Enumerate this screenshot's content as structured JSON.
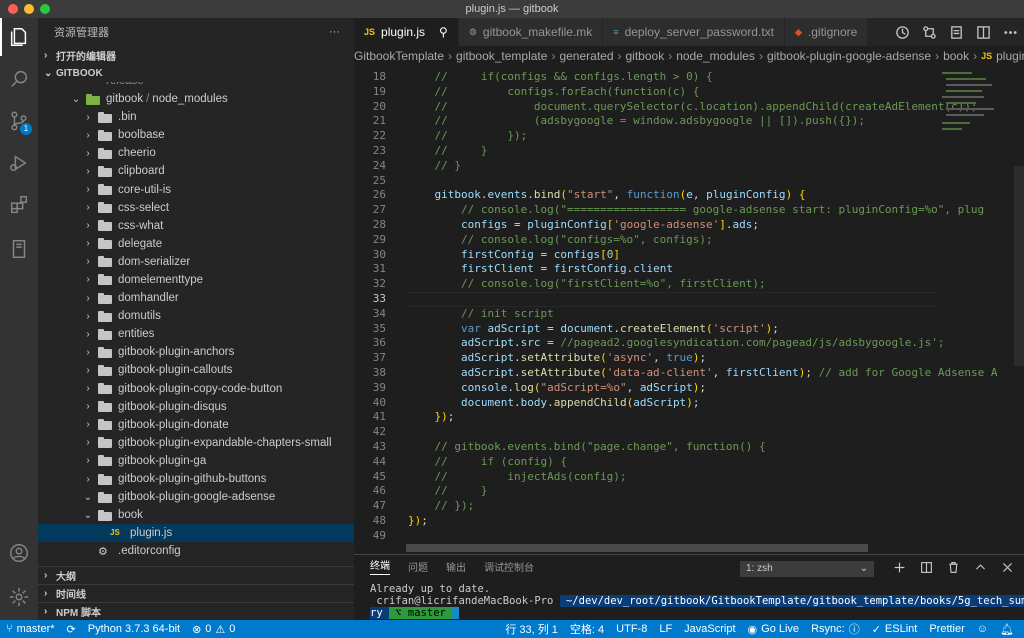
{
  "window": {
    "title": "plugin.js — gitbook"
  },
  "sidebar": {
    "header": "资源管理器",
    "more": "···",
    "open_editors": "打开的编辑器",
    "root": "GITBOOK",
    "partial_row": "release",
    "items": [
      {
        "label": "gitbook",
        "sep": "/",
        "label2": "node_modules",
        "type": "folder-green",
        "expanded": true
      },
      {
        "label": ".bin"
      },
      {
        "label": "boolbase"
      },
      {
        "label": "cheerio"
      },
      {
        "label": "clipboard"
      },
      {
        "label": "core-util-is"
      },
      {
        "label": "css-select"
      },
      {
        "label": "css-what"
      },
      {
        "label": "delegate"
      },
      {
        "label": "dom-serializer"
      },
      {
        "label": "domelementtype"
      },
      {
        "label": "domhandler"
      },
      {
        "label": "domutils"
      },
      {
        "label": "entities"
      },
      {
        "label": "gitbook-plugin-anchors"
      },
      {
        "label": "gitbook-plugin-callouts"
      },
      {
        "label": "gitbook-plugin-copy-code-button"
      },
      {
        "label": "gitbook-plugin-disqus"
      },
      {
        "label": "gitbook-plugin-donate"
      },
      {
        "label": "gitbook-plugin-expandable-chapters-small"
      },
      {
        "label": "gitbook-plugin-ga"
      },
      {
        "label": "gitbook-plugin-github-buttons"
      },
      {
        "label": "gitbook-plugin-google-adsense"
      }
    ],
    "book_folder": "book",
    "selected_file": "plugin.js",
    "editorconfig": ".editorconfig",
    "outline": "大纲",
    "timeline": "时间线",
    "npm_scripts": "NPM 脚本"
  },
  "activity": {
    "scm_badge": "1"
  },
  "tabs": [
    {
      "label": "plugin.js",
      "icon": "JS",
      "active": true
    },
    {
      "label": "gitbook_makefile.mk",
      "icon": "⚙"
    },
    {
      "label": "deploy_server_password.txt",
      "icon": "≡"
    },
    {
      "label": ".gitignore",
      "icon": "◆"
    }
  ],
  "breadcrumb": [
    "GitbookTemplate",
    "gitbook_template",
    "generated",
    "gitbook",
    "node_modules",
    "gitbook-plugin-google-adsense",
    "book",
    "plugin.js"
  ],
  "editor": {
    "lines": [
      {
        "n": "18",
        "text": "    //     if(configs && configs.length > 0) {"
      },
      {
        "n": "19",
        "text": "    //         configs.forEach(function(c) {"
      },
      {
        "n": "20",
        "text": "    //             document.querySelector(c.location).appendChild(createAdElement(c));"
      },
      {
        "n": "21",
        "text": "    //             (adsbygoogle = window.adsbygoogle || []).push({});"
      },
      {
        "n": "22",
        "text": "    //         });"
      },
      {
        "n": "23",
        "text": "    //     }"
      },
      {
        "n": "24",
        "text": "    // }"
      },
      {
        "n": "25",
        "text": ""
      },
      {
        "n": "26",
        "text": "    gitbook.events.bind(\"start\", function(e, pluginConfig) {"
      },
      {
        "n": "27",
        "text": "        // console.log(\"================== google-adsense start: pluginConfig=%o\", plug"
      },
      {
        "n": "28",
        "text": "        configs = pluginConfig['google-adsense'].ads;"
      },
      {
        "n": "29",
        "text": "        // console.log(\"configs=%o\", configs);"
      },
      {
        "n": "30",
        "text": "        firstConfig = configs[0]"
      },
      {
        "n": "31",
        "text": "        firstClient = firstConfig.client"
      },
      {
        "n": "32",
        "text": "        // console.log(\"firstClient=%o\", firstClient);"
      },
      {
        "n": "33",
        "text": ""
      },
      {
        "n": "34",
        "text": "        // init script"
      },
      {
        "n": "35",
        "text": "        var adScript = document.createElement('script');"
      },
      {
        "n": "36",
        "text": "        adScript.src = '//pagead2.googlesyndication.com/pagead/js/adsbygoogle.js';"
      },
      {
        "n": "37",
        "text": "        adScript.setAttribute('async', true);"
      },
      {
        "n": "38",
        "text": "        adScript.setAttribute('data-ad-client', firstClient); // add for Google Adsense A"
      },
      {
        "n": "39",
        "text": "        console.log(\"adScript=%o\", adScript);"
      },
      {
        "n": "40",
        "text": "        document.body.appendChild(adScript);"
      },
      {
        "n": "41",
        "text": "    });"
      },
      {
        "n": "42",
        "text": ""
      },
      {
        "n": "43",
        "text": "    // gitbook.events.bind(\"page.change\", function() {"
      },
      {
        "n": "44",
        "text": "    //     if (config) {"
      },
      {
        "n": "45",
        "text": "    //         injectAds(config);"
      },
      {
        "n": "46",
        "text": "    //     }"
      },
      {
        "n": "47",
        "text": "    // });"
      },
      {
        "n": "48",
        "text": "});"
      },
      {
        "n": "49",
        "text": ""
      }
    ]
  },
  "panel": {
    "tabs": [
      "终端",
      "问题",
      "输出",
      "调试控制台"
    ],
    "terminal_select": "1: zsh",
    "line1": "Already up to date.",
    "prompt_user": " crifan@licrifandeMacBook-Pro ",
    "prompt_path": " ~/dev/dev_root/gitbook/GitbookTemplate/gitbook_template/books/5g_tech_summa",
    "prompt_path2": "ry ",
    "prompt_branch": " ⌥ master ",
    "cursor": " "
  },
  "statusbar": {
    "branch": "master*",
    "python": "Python 3.7.3 64-bit",
    "problems": "0",
    "warnings": "0",
    "position": "行 33, 列 1",
    "spaces": "空格: 4",
    "encoding": "UTF-8",
    "eol": "LF",
    "language": "JavaScript",
    "golive": "Go Live",
    "rsync": "Rsync:",
    "eslint": "ESLint",
    "prettier": "Prettier"
  },
  "colors": {
    "accent": "#007acc",
    "selection": "#04395e"
  }
}
